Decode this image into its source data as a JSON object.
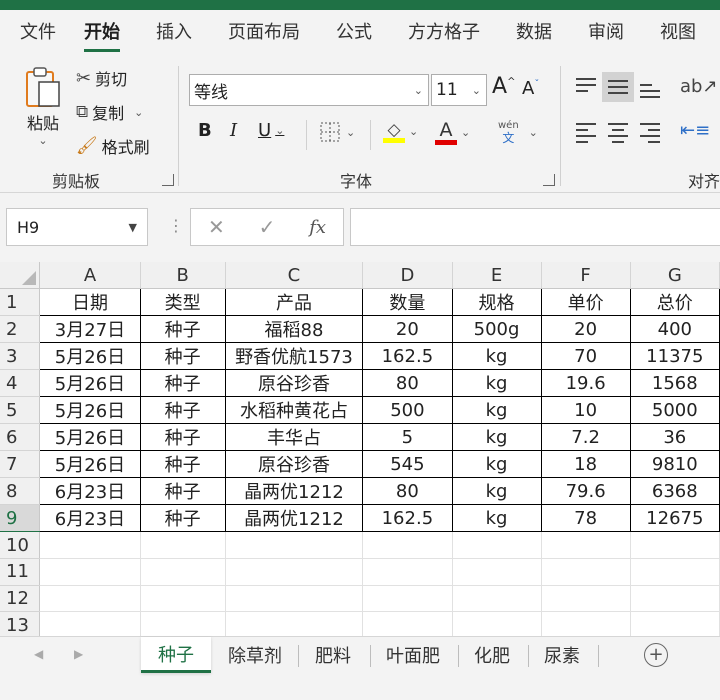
{
  "ribbon_tabs": [
    "文件",
    "开始",
    "插入",
    "页面布局",
    "公式",
    "方方格子",
    "数据",
    "审阅",
    "视图"
  ],
  "active_tab": "开始",
  "clipboard": {
    "paste_label": "粘贴",
    "cut_label": "剪切",
    "copy_label": "复制",
    "format_painter_label": "格式刷",
    "group_label": "剪贴板"
  },
  "font": {
    "font_name": "等线",
    "font_size": "11",
    "bold": "B",
    "italic": "I",
    "underline": "U",
    "font_color_glyph": "A",
    "phonetic_top": "wén",
    "phonetic_bottom": "文",
    "group_label": "字体",
    "highlight_color": "#ffff00",
    "font_color": "#e00000"
  },
  "alignment": {
    "group_label": "对齐"
  },
  "formula_bar": {
    "name_box": "H9",
    "cancel": "✕",
    "enter": "✓",
    "fx": "fx",
    "value": ""
  },
  "grid": {
    "columns": [
      "A",
      "B",
      "C",
      "D",
      "E",
      "F",
      "G"
    ],
    "row_numbers": [
      "1",
      "2",
      "3",
      "4",
      "5",
      "6",
      "7",
      "8",
      "9",
      "10",
      "11",
      "12",
      "13"
    ],
    "headers": [
      "日期",
      "类型",
      "产品",
      "数量",
      "规格",
      "单价",
      "总价"
    ],
    "rows": [
      [
        "3月27日",
        "种子",
        "福稻88",
        "20",
        "500g",
        "20",
        "400"
      ],
      [
        "5月26日",
        "种子",
        "野香优航1573",
        "162.5",
        "kg",
        "70",
        "11375"
      ],
      [
        "5月26日",
        "种子",
        "原谷珍香",
        "80",
        "kg",
        "19.6",
        "1568"
      ],
      [
        "5月26日",
        "种子",
        "水稻种黄花占",
        "500",
        "kg",
        "10",
        "5000"
      ],
      [
        "5月26日",
        "种子",
        "丰华占",
        "5",
        "kg",
        "7.2",
        "36"
      ],
      [
        "5月26日",
        "种子",
        "原谷珍香",
        "545",
        "kg",
        "18",
        "9810"
      ],
      [
        "6月23日",
        "种子",
        "晶两优1212",
        "80",
        "kg",
        "79.6",
        "6368"
      ],
      [
        "6月23日",
        "种子",
        "晶两优1212",
        "162.5",
        "kg",
        "78",
        "12675"
      ]
    ],
    "selected_cell": "H9",
    "accent": "#1f7145"
  },
  "sheets": {
    "tabs": [
      "种子",
      "除草剂",
      "肥料",
      "叶面肥",
      "化肥",
      "尿素"
    ],
    "active": "种子",
    "add_label": "+"
  }
}
